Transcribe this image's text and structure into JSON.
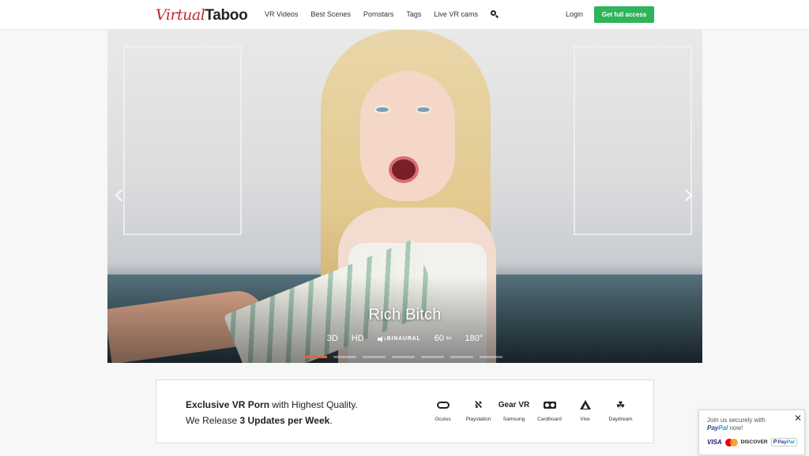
{
  "header": {
    "logo_part1": "Virtual",
    "logo_part2": "Taboo",
    "nav": [
      "VR Videos",
      "Best Scenes",
      "Pornstars",
      "Tags",
      "Live VR cams"
    ],
    "search_icon": "search-icon",
    "login_label": "Login",
    "cta_label": "Get full access",
    "cta_color": "#2fb35b",
    "brand_color": "#c4262e"
  },
  "hero": {
    "title": "Rich Bitch",
    "features": {
      "3d": "3D",
      "hd": "HD",
      "binaural": "BINAURAL",
      "fps": "60",
      "fps_unit": "fps",
      "fov": "180°"
    },
    "slide_count": 7,
    "active_slide": 1,
    "active_color": "#e0653b"
  },
  "info": {
    "line1_bold": "Exclusive VR Porn",
    "line1_rest": " with Highest Quality.",
    "line2_pre": "We Release ",
    "line2_bold": "3 Updates per Week",
    "line2_post": ".",
    "devices": [
      {
        "label": "Oculus",
        "icon": "oculus-icon"
      },
      {
        "label": "Playstation",
        "icon": "playstation-icon"
      },
      {
        "label": "Samsung",
        "icon": "gear-vr-icon",
        "text": "Gear VR"
      },
      {
        "label": "Cardboard",
        "icon": "cardboard-icon"
      },
      {
        "label": "Vive",
        "icon": "vive-icon"
      },
      {
        "label": "Daydream",
        "icon": "daydream-icon"
      }
    ]
  },
  "paypal": {
    "line1": "Join us securely with",
    "brand_a": "Pay",
    "brand_b": "Pal",
    "line2_rest": " now!",
    "close_label": "✕",
    "visa": "VISA",
    "discover": "DISCOVER",
    "badge_a": "Pay",
    "badge_b": "Pal"
  }
}
